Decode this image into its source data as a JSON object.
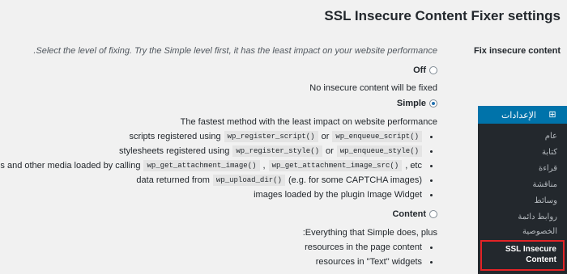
{
  "header": {
    "title": "SSL Insecure Content Fixer settings"
  },
  "section": {
    "label": "Fix insecure content"
  },
  "intro": ".Select the level of fixing. Try the Simple level first, it has the least impact on your website performance",
  "options": {
    "off": {
      "label": "Off",
      "checked": false,
      "description": "No insecure content will be fixed"
    },
    "simple": {
      "label": "Simple",
      "checked": true,
      "description": "The fastest method with the least impact on website performance",
      "bullets": [
        {
          "text_before": "scripts registered using",
          "code1": "wp_register_script()",
          "mid": "or",
          "code2": "wp_enqueue_script()",
          "after": ""
        },
        {
          "text_before": "stylesheets registered using",
          "code1": "wp_register_style()",
          "mid": "or",
          "code2": "wp_enqueue_style()",
          "after": ""
        },
        {
          "text_before": ".images and other media loaded by calling",
          "code1": "wp_get_attachment_image()",
          "mid": ",",
          "code2": "wp_get_attachment_image_src()",
          "after": ", etc"
        },
        {
          "text_before": "data returned from",
          "code1": "wp_upload_dir()",
          "after": "(e.g. for some CAPTCHA images)"
        },
        {
          "text_before": "images loaded by the plugin Image Widget"
        }
      ]
    },
    "content": {
      "label": "Content",
      "checked": false,
      "description": ":Everything that Simple does, plus",
      "bullets": [
        "resources in the page content",
        "resources in \"Text\" widgets"
      ]
    }
  },
  "sidebar": {
    "heading": "الإعدادات",
    "heading_icon": "settings-plus-icon",
    "items": [
      "عام",
      "كتابة",
      "قراءة",
      "مناقشة",
      "وسائط",
      "روابط دائمة",
      "الخصوصية"
    ],
    "current_line1": "SSL Insecure",
    "current_line2": "Content"
  },
  "colors": {
    "accent": "#0073aa",
    "sidebar_bg": "#23282d",
    "highlight": "#e32326"
  }
}
